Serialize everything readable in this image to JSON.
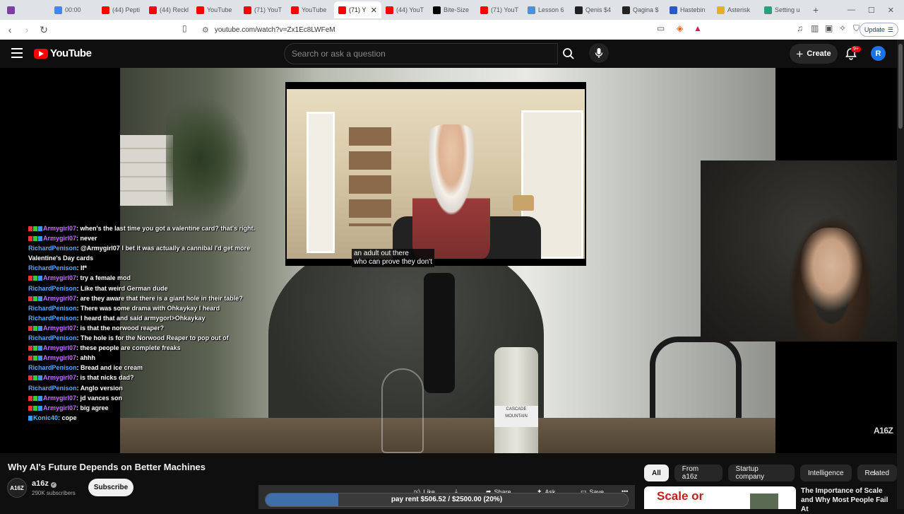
{
  "browser": {
    "tabs": [
      {
        "label": "",
        "color": "#7b3fa0",
        "active": false
      },
      {
        "label": "00:00",
        "color": "#4285f4",
        "active": false
      },
      {
        "label": "(44) Pepti",
        "color": "#ff0000",
        "active": false
      },
      {
        "label": "(44) Reckl",
        "color": "#ff0000",
        "active": false
      },
      {
        "label": "YouTube",
        "color": "#ff0000",
        "active": false
      },
      {
        "label": "(71) YouT",
        "color": "#ff0000",
        "active": false
      },
      {
        "label": "YouTube",
        "color": "#ff0000",
        "active": false
      },
      {
        "label": "(71) Y",
        "color": "#ff0000",
        "active": true
      },
      {
        "label": "(44) YouT",
        "color": "#ff0000",
        "active": false
      },
      {
        "label": "Bite-Size",
        "color": "#000000",
        "active": false
      },
      {
        "label": "(71) YouT",
        "color": "#ff0000",
        "active": false
      },
      {
        "label": "Lesson 6",
        "color": "#4a90e2",
        "active": false
      },
      {
        "label": "Qenis $4",
        "color": "#222222",
        "active": false
      },
      {
        "label": "Qagina $",
        "color": "#222222",
        "active": false
      },
      {
        "label": "Hastebin",
        "color": "#2b59c3",
        "active": false
      },
      {
        "label": "Asterisk",
        "color": "#e8b01e",
        "active": false
      },
      {
        "label": "Setting u",
        "color": "#2aa07a",
        "active": false
      }
    ],
    "url": "youtube.com/watch?v=Zx1Ec8LWFeM",
    "update_label": "Update"
  },
  "youtube": {
    "logo_text": "YouTube",
    "search_placeholder": "Search or ask a question",
    "create_label": "Create",
    "notifications_badge": "9+",
    "account_initial": "R"
  },
  "video": {
    "caption_line1": "an adult out there",
    "caption_line2": "who can prove they don't",
    "watermark": "A16Z",
    "bottle_label": "CASCADE MOUNTAIN"
  },
  "chat": [
    {
      "user": "Armygirl07",
      "type": "a",
      "msg": "when's the last time you got a valentine card? that's right."
    },
    {
      "user": "Armygirl07",
      "type": "a",
      "msg": "never"
    },
    {
      "user": "RichardPenison",
      "type": "r",
      "msg": "@Armygirl07 I bet it was actually a cannibal I'd get more Valentine's Day cards"
    },
    {
      "user": "RichardPenison",
      "type": "r",
      "msg": "If*"
    },
    {
      "user": "Armygirl07",
      "type": "a",
      "msg": "try a female mod"
    },
    {
      "user": "RichardPenison",
      "type": "r",
      "msg": "Like that weird German dude"
    },
    {
      "user": "Armygirl07",
      "type": "a",
      "msg": "are they aware that there is a giant hole in their table?"
    },
    {
      "user": "RichardPenison",
      "type": "r",
      "msg": "There was some drama with Ohkaykay I heard"
    },
    {
      "user": "RichardPenison",
      "type": "r",
      "msg": "I heard that and said armygorl>Ohkaykay"
    },
    {
      "user": "Armygirl07",
      "type": "a",
      "msg": "is that the norwood reaper?"
    },
    {
      "user": "RichardPenison",
      "type": "r",
      "msg": "The hole is for the Norwood Reaper to pop out of"
    },
    {
      "user": "Armygirl07",
      "type": "a",
      "msg": "these people are complete freaks"
    },
    {
      "user": "Armygirl07",
      "type": "a",
      "msg": "ahhh"
    },
    {
      "user": "RichardPenison",
      "type": "r",
      "msg": "Bread and ice cream"
    },
    {
      "user": "Armygirl07",
      "type": "a",
      "msg": "is that nicks dad?"
    },
    {
      "user": "RichardPenison",
      "type": "r",
      "msg": "Anglo version"
    },
    {
      "user": "Armygirl07",
      "type": "a",
      "msg": "jd vances son"
    },
    {
      "user": "Armygirl07",
      "type": "a",
      "msg": "big agree"
    },
    {
      "user": "Konic40",
      "type": "k",
      "msg": "cope"
    }
  ],
  "below": {
    "title": "Why AI's Future Depends on Better Machines",
    "channel_name": "a16z",
    "channel_avatar": "A16Z",
    "subscribers": "290K subscribers",
    "subscribe_label": "Subscribe",
    "actions": {
      "like": "Like",
      "share": "Share",
      "ask": "Ask",
      "save": "Save"
    },
    "rent_text": "pay rent $506.52 / $2500.00 (20%)",
    "rent_progress": 0.2,
    "chips": [
      "All",
      "From a16z",
      "Startup company",
      "Intelligence",
      "Related"
    ],
    "rec_thumb_text": "Scale or",
    "rec_title": "The Importance of Scale and Why Most People Fail At"
  }
}
